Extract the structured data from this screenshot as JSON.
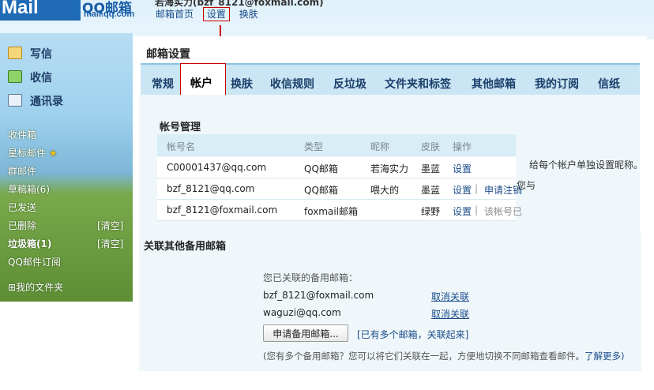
{
  "header": {
    "logo_text": "Mail",
    "logo_name": "QQ邮箱",
    "logo_domain": "mail.qq.com",
    "account_line": "若海实力(bzf_8121@foxmail.com)",
    "nav": [
      "邮箱首页",
      "设置",
      "换肤"
    ]
  },
  "sidebar": {
    "quick": [
      {
        "label": "写信",
        "icon": "pencil-icon"
      },
      {
        "label": "收信",
        "icon": "inbox-download-icon"
      },
      {
        "label": "通讯录",
        "icon": "contacts-card-icon"
      }
    ],
    "folders": [
      "收件箱",
      "星标邮件",
      "群邮件",
      "草稿箱(6)",
      "已发送",
      "已删除",
      "垃圾箱(1)",
      "QQ邮件订阅"
    ],
    "clear_deleted": "[清空]",
    "clear_spam": "[清空]",
    "my_folders": "我的文件夹"
  },
  "settings": {
    "title": "邮箱设置",
    "tabs": [
      "常规",
      "帐户",
      "换肤",
      "收信规则",
      "反垃圾",
      "文件夹和标签",
      "其他邮箱",
      "我的订阅",
      "信纸"
    ],
    "account_mgmt_title": "帐号管理",
    "columns": [
      "帐号名",
      "类型",
      "昵称",
      "皮肤",
      "操作"
    ],
    "accounts": [
      {
        "name": "C00001437@qq.com",
        "type": "QQ邮箱",
        "nickname": "若海实力",
        "skin": "墨蓝",
        "op": "设置",
        "extra": ""
      },
      {
        "name": "bzf_8121@qq.com",
        "type": "QQ邮箱",
        "nickname": "喂大的",
        "skin": "墨蓝",
        "op": "设置",
        "extra": "申请注销"
      },
      {
        "name": "bzf_8121@foxmail.com",
        "type": "foxmail邮箱",
        "nickname": "",
        "skin": "绿野",
        "op": "设置",
        "extra": "该帐号已"
      }
    ],
    "side_note": "给每个帐户单独设置昵称。",
    "side_note2": "您与",
    "backup": {
      "title": "关联其他备用邮箱",
      "linked_label": "您已关联的备用邮箱：",
      "emails": [
        "bzf_8121@foxmail.com",
        "waguzi@qq.com"
      ],
      "unlink": "取消关联",
      "apply_button": "申请备用邮箱...",
      "hint": "[已有多个邮箱，关联起来]",
      "footer": "(您有多个备用邮箱？您可以将它们关联在一起，方便地切换不同邮箱查看邮件。",
      "learn_more": "了解更多)"
    }
  },
  "colors": {
    "annotation_red": "#cc0000",
    "link": "#1a4c8a",
    "tab_bg": "#cae5f3"
  }
}
